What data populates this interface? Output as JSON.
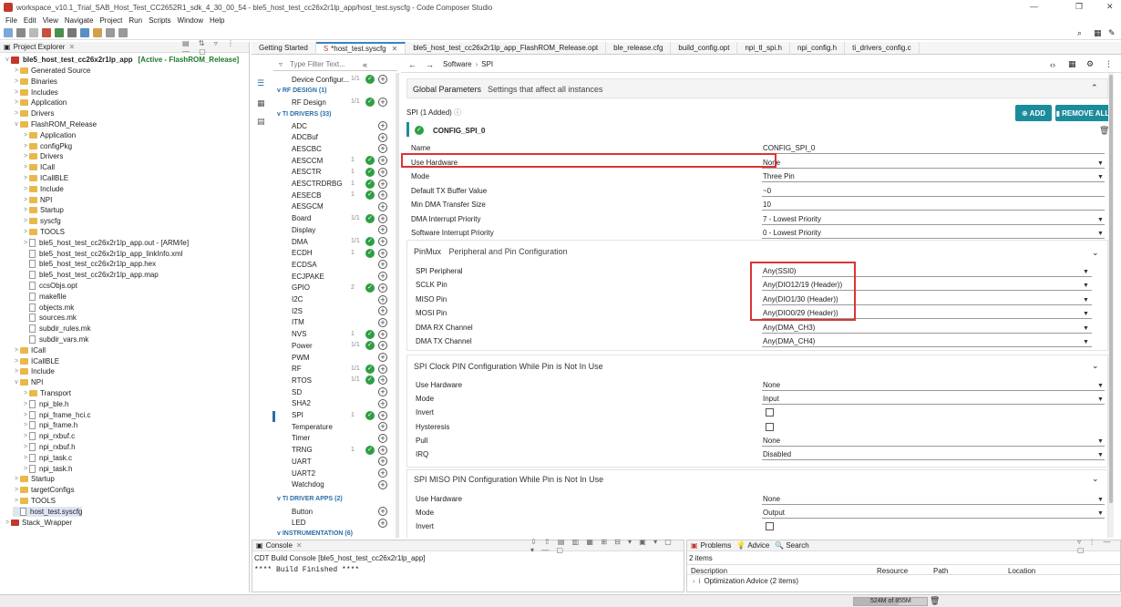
{
  "window": {
    "title": "workspace_v10.1_Trial_SAB_Host_Test_CC2652R1_sdk_4_30_00_54 - ble5_host_test_cc26x2r1lp_app/host_test.syscfg - Code Composer Studio"
  },
  "menu": [
    "File",
    "Edit",
    "View",
    "Navigate",
    "Project",
    "Run",
    "Scripts",
    "Window",
    "Help"
  ],
  "project_explorer": {
    "title": "Project Explorer",
    "root": "ble5_host_test_cc26x2r1lp_app",
    "root_tag": "[Active - FlashROM_Release]",
    "items": [
      {
        "label": "Generated Source",
        "indent": 1,
        "kind": "folder",
        "tw": ">"
      },
      {
        "label": "Binaries",
        "indent": 1,
        "kind": "folder",
        "tw": ">"
      },
      {
        "label": "Includes",
        "indent": 1,
        "kind": "folder",
        "tw": ">"
      },
      {
        "label": "Application",
        "indent": 1,
        "kind": "folder",
        "tw": ">"
      },
      {
        "label": "Drivers",
        "indent": 1,
        "kind": "folder",
        "tw": ">"
      },
      {
        "label": "FlashROM_Release",
        "indent": 1,
        "kind": "folder",
        "tw": "v"
      },
      {
        "label": "Application",
        "indent": 2,
        "kind": "folder",
        "tw": ">"
      },
      {
        "label": "configPkg",
        "indent": 2,
        "kind": "folder",
        "tw": ">"
      },
      {
        "label": "Drivers",
        "indent": 2,
        "kind": "folder",
        "tw": ">"
      },
      {
        "label": "ICall",
        "indent": 2,
        "kind": "folder",
        "tw": ">"
      },
      {
        "label": "ICallBLE",
        "indent": 2,
        "kind": "folder",
        "tw": ">"
      },
      {
        "label": "Include",
        "indent": 2,
        "kind": "folder",
        "tw": ">"
      },
      {
        "label": "NPI",
        "indent": 2,
        "kind": "folder",
        "tw": ">"
      },
      {
        "label": "Startup",
        "indent": 2,
        "kind": "folder",
        "tw": ">"
      },
      {
        "label": "syscfg",
        "indent": 2,
        "kind": "folder",
        "tw": ">"
      },
      {
        "label": "TOOLS",
        "indent": 2,
        "kind": "folder",
        "tw": ">"
      },
      {
        "label": "ble5_host_test_cc26x2r1lp_app.out - [ARM/le]",
        "indent": 2,
        "kind": "file",
        "tw": ">"
      },
      {
        "label": "ble5_host_test_cc26x2r1lp_app_linkInfo.xml",
        "indent": 2,
        "kind": "file",
        "tw": ""
      },
      {
        "label": "ble5_host_test_cc26x2r1lp_app.hex",
        "indent": 2,
        "kind": "file",
        "tw": ""
      },
      {
        "label": "ble5_host_test_cc26x2r1lp_app.map",
        "indent": 2,
        "kind": "file",
        "tw": ""
      },
      {
        "label": "ccsObjs.opt",
        "indent": 2,
        "kind": "file",
        "tw": ""
      },
      {
        "label": "makefile",
        "indent": 2,
        "kind": "file",
        "tw": ""
      },
      {
        "label": "objects.mk",
        "indent": 2,
        "kind": "file",
        "tw": ""
      },
      {
        "label": "sources.mk",
        "indent": 2,
        "kind": "file",
        "tw": ""
      },
      {
        "label": "subdir_rules.mk",
        "indent": 2,
        "kind": "file",
        "tw": ""
      },
      {
        "label": "subdir_vars.mk",
        "indent": 2,
        "kind": "file",
        "tw": ""
      },
      {
        "label": "ICall",
        "indent": 1,
        "kind": "folder",
        "tw": ">"
      },
      {
        "label": "ICallBLE",
        "indent": 1,
        "kind": "folder",
        "tw": ">"
      },
      {
        "label": "Include",
        "indent": 1,
        "kind": "folder",
        "tw": ">"
      },
      {
        "label": "NPI",
        "indent": 1,
        "kind": "folder",
        "tw": "v"
      },
      {
        "label": "Transport",
        "indent": 2,
        "kind": "folder",
        "tw": ">"
      },
      {
        "label": "npi_ble.h",
        "indent": 2,
        "kind": "file",
        "tw": ">"
      },
      {
        "label": "npi_frame_hci.c",
        "indent": 2,
        "kind": "file",
        "tw": ">"
      },
      {
        "label": "npi_frame.h",
        "indent": 2,
        "kind": "file",
        "tw": ">"
      },
      {
        "label": "npi_rxbuf.c",
        "indent": 2,
        "kind": "file",
        "tw": ">"
      },
      {
        "label": "npi_rxbuf.h",
        "indent": 2,
        "kind": "file",
        "tw": ">"
      },
      {
        "label": "npi_task.c",
        "indent": 2,
        "kind": "file",
        "tw": ">"
      },
      {
        "label": "npi_task.h",
        "indent": 2,
        "kind": "file",
        "tw": ">"
      },
      {
        "label": "Startup",
        "indent": 1,
        "kind": "folder",
        "tw": ">"
      },
      {
        "label": "targetConfigs",
        "indent": 1,
        "kind": "folder",
        "tw": ">"
      },
      {
        "label": "TOOLS",
        "indent": 1,
        "kind": "folder",
        "tw": ">"
      },
      {
        "label": "host_test.syscfg",
        "indent": 1,
        "kind": "file",
        "tw": ""
      },
      {
        "label": "Stack_Wrapper",
        "indent": 0,
        "kind": "project",
        "tw": ">"
      }
    ]
  },
  "tabs": [
    "Getting Started",
    "*host_test.syscfg",
    "ble5_host_test_cc26x2r1lp_app_FlashROM_Release.opt",
    "ble_release.cfg",
    "build_config.opt",
    "npi_tl_spi.h",
    "npi_config.h",
    "ti_drivers_config.c"
  ],
  "filter_placeholder": "Type Filter Text...",
  "modules": {
    "top": [
      {
        "name": "Device Configur...",
        "count": "1/1",
        "checked": true
      }
    ],
    "rf_section": "RF DESIGN (1)",
    "rf": [
      {
        "name": "RF Design",
        "count": "1/1",
        "checked": true
      }
    ],
    "drivers_section": "TI DRIVERS (33)",
    "drivers": [
      {
        "name": "ADC",
        "count": "",
        "checked": false
      },
      {
        "name": "ADCBuf",
        "count": "",
        "checked": false
      },
      {
        "name": "AESCBC",
        "count": "",
        "checked": false
      },
      {
        "name": "AESCCM",
        "count": "1",
        "checked": true
      },
      {
        "name": "AESCTR",
        "count": "1",
        "checked": true
      },
      {
        "name": "AESCTRDRBG",
        "count": "1",
        "checked": true
      },
      {
        "name": "AESECB",
        "count": "1",
        "checked": true
      },
      {
        "name": "AESGCM",
        "count": "",
        "checked": false
      },
      {
        "name": "Board",
        "count": "1/1",
        "checked": true
      },
      {
        "name": "Display",
        "count": "",
        "checked": false
      },
      {
        "name": "DMA",
        "count": "1/1",
        "checked": true
      },
      {
        "name": "ECDH",
        "count": "1",
        "checked": true
      },
      {
        "name": "ECDSA",
        "count": "",
        "checked": false
      },
      {
        "name": "ECJPAKE",
        "count": "",
        "checked": false
      },
      {
        "name": "GPIO",
        "count": "2",
        "checked": true
      },
      {
        "name": "I2C",
        "count": "",
        "checked": false
      },
      {
        "name": "I2S",
        "count": "",
        "checked": false
      },
      {
        "name": "ITM",
        "count": "",
        "checked": false
      },
      {
        "name": "NVS",
        "count": "1",
        "checked": true
      },
      {
        "name": "Power",
        "count": "1/1",
        "checked": true
      },
      {
        "name": "PWM",
        "count": "",
        "checked": false
      },
      {
        "name": "RF",
        "count": "1/1",
        "checked": true
      },
      {
        "name": "RTOS",
        "count": "1/1",
        "checked": true
      },
      {
        "name": "SD",
        "count": "",
        "checked": false
      },
      {
        "name": "SHA2",
        "count": "",
        "checked": false
      },
      {
        "name": "SPI",
        "count": "1",
        "checked": true
      },
      {
        "name": "Temperature",
        "count": "",
        "checked": false
      },
      {
        "name": "Timer",
        "count": "",
        "checked": false
      },
      {
        "name": "TRNG",
        "count": "1",
        "checked": true
      },
      {
        "name": "UART",
        "count": "",
        "checked": false
      },
      {
        "name": "UART2",
        "count": "",
        "checked": false
      },
      {
        "name": "Watchdog",
        "count": "",
        "checked": false
      }
    ],
    "apps_section": "TI DRIVER APPS (2)",
    "apps": [
      {
        "name": "Button",
        "count": "",
        "checked": false
      },
      {
        "name": "LED",
        "count": "",
        "checked": false
      }
    ],
    "instr_section": "INSTRUMENTATION (6)"
  },
  "breadcrumb": {
    "a": "Software",
    "b": "SPI"
  },
  "global_params": {
    "title": "Global Parameters",
    "subtitle": "Settings that affect all instances"
  },
  "spi": {
    "header": "SPI (1 Added)",
    "instance": "CONFIG_SPI_0",
    "add_label": "ADD",
    "remove_label": "REMOVE ALL",
    "fields": [
      {
        "label": "Name",
        "value": "CONFIG_SPI_0",
        "dropdown": false
      },
      {
        "label": "Use Hardware",
        "value": "None",
        "dropdown": true
      },
      {
        "label": "Mode",
        "value": "Three Pin",
        "dropdown": true
      },
      {
        "label": "Default TX Buffer Value",
        "value": "~0",
        "dropdown": false
      },
      {
        "label": "Min DMA Transfer Size",
        "value": "10",
        "dropdown": false
      },
      {
        "label": "DMA Interrupt Priority",
        "value": "7 - Lowest Priority",
        "dropdown": true
      },
      {
        "label": "Software Interrupt Priority",
        "value": "0 - Lowest Priority",
        "dropdown": true
      }
    ]
  },
  "pinmux": {
    "title": "PinMux",
    "subtitle": "Peripheral and Pin Configuration",
    "fields": [
      {
        "label": "SPI Peripheral",
        "value": "Any(SSI0)"
      },
      {
        "label": "SCLK Pin",
        "value": "Any(DIO12/19 (Header))"
      },
      {
        "label": "MISO Pin",
        "value": "Any(DIO1/30 (Header))"
      },
      {
        "label": "MOSI Pin",
        "value": "Any(DIO0/29 (Header))"
      },
      {
        "label": "DMA RX Channel",
        "value": "Any(DMA_CH3)"
      },
      {
        "label": "DMA TX Channel",
        "value": "Any(DMA_CH4)"
      }
    ]
  },
  "clock_cfg": {
    "title": "SPI Clock PIN Configuration While Pin is Not In Use",
    "fields": [
      {
        "label": "Use Hardware",
        "value": "None",
        "type": "select"
      },
      {
        "label": "Mode",
        "value": "Input",
        "type": "select"
      },
      {
        "label": "Invert",
        "value": "",
        "type": "checkbox"
      },
      {
        "label": "Hysteresis",
        "value": "",
        "type": "checkbox"
      },
      {
        "label": "Pull",
        "value": "None",
        "type": "select"
      },
      {
        "label": "IRQ",
        "value": "Disabled",
        "type": "select"
      }
    ]
  },
  "miso_cfg": {
    "title": "SPI MISO PIN Configuration While Pin is Not In Use",
    "fields": [
      {
        "label": "Use Hardware",
        "value": "None",
        "type": "select"
      },
      {
        "label": "Mode",
        "value": "Output",
        "type": "select"
      },
      {
        "label": "Invert",
        "value": "",
        "type": "checkbox"
      }
    ]
  },
  "console": {
    "tab": "Console",
    "subtitle": "CDT Build Console [ble5_host_test_cc26x2r1lp_app]",
    "text": "**** Build Finished ****"
  },
  "problems": {
    "tabs": [
      "Problems",
      "Advice",
      "Search"
    ],
    "count": "2 items",
    "columns": [
      "Description",
      "Resource",
      "Path",
      "Location"
    ],
    "rows": [
      "Optimization Advice (2 items)"
    ]
  },
  "status": {
    "memory": "524M of 855M"
  }
}
